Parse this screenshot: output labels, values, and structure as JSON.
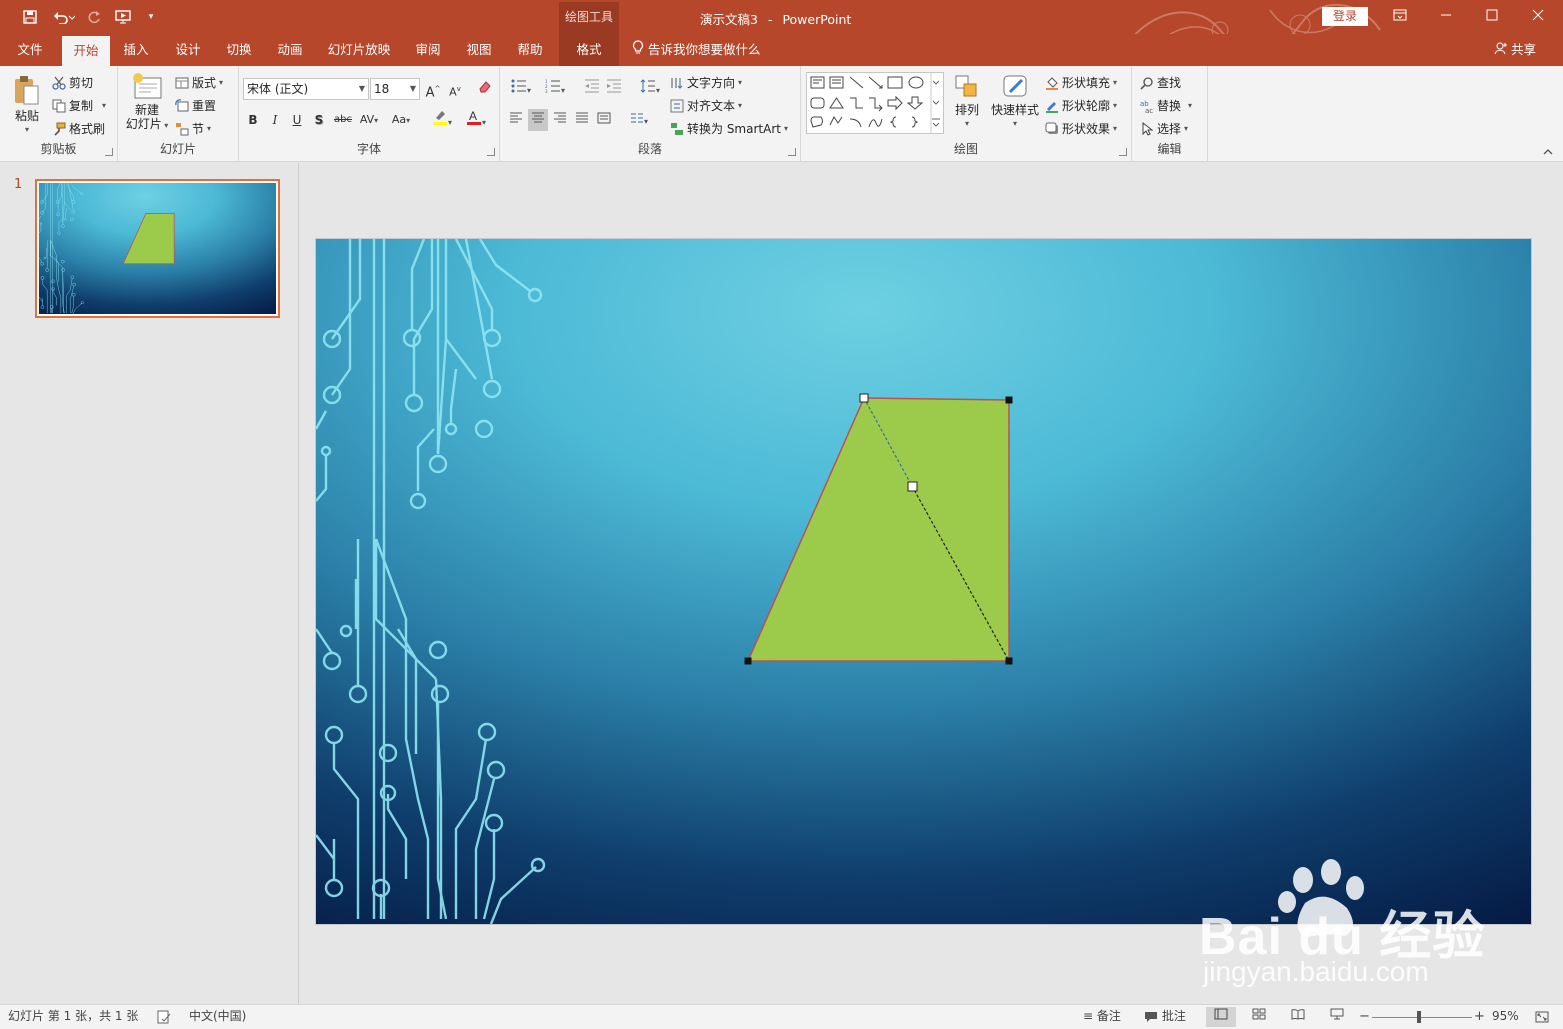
{
  "window": {
    "context_group": "绘图工具",
    "title_doc": "演示文稿3",
    "title_sep": "-",
    "title_app": "PowerPoint",
    "login": "登录"
  },
  "tabs": [
    {
      "label": "文件"
    },
    {
      "label": "开始"
    },
    {
      "label": "插入"
    },
    {
      "label": "设计"
    },
    {
      "label": "切换"
    },
    {
      "label": "动画"
    },
    {
      "label": "幻灯片放映"
    },
    {
      "label": "审阅"
    },
    {
      "label": "视图"
    },
    {
      "label": "帮助"
    },
    {
      "label": "格式"
    }
  ],
  "tell_me": "告诉我你想要做什么",
  "share": "共享",
  "ribbon": {
    "clipboard": {
      "label": "剪贴板",
      "paste": "粘贴",
      "cut": "剪切",
      "copy": "复制",
      "format_painter": "格式刷"
    },
    "slides": {
      "label": "幻灯片",
      "new_slide_1": "新建",
      "new_slide_2": "幻灯片",
      "layout": "版式",
      "reset": "重置",
      "section": "节"
    },
    "font": {
      "label": "字体",
      "font_name": "宋体 (正文)",
      "font_size": "18",
      "bold": "B",
      "italic": "I",
      "underline": "U",
      "shadow": "S",
      "strike": "abc",
      "spacing": "AV",
      "case": "Aa",
      "grow": "A",
      "shrink": "A"
    },
    "paragraph": {
      "label": "段落",
      "text_direction": "文字方向",
      "align_text": "对齐文本",
      "smartart": "转换为 SmartArt"
    },
    "drawing": {
      "label": "绘图",
      "arrange": "排列",
      "quick_styles": "快速样式",
      "shape_fill": "形状填充",
      "shape_outline": "形状轮廓",
      "shape_effects": "形状效果"
    },
    "editing": {
      "label": "编辑",
      "find": "查找",
      "replace": "替换",
      "select": "选择"
    }
  },
  "slide_panel": {
    "number": "1"
  },
  "status": {
    "slide_info": "幻灯片 第 1 张，共 1 张",
    "language": "中文(中国)",
    "notes": "备注",
    "comments": "批注",
    "zoom": "95%",
    "zoom_level": 0.95
  },
  "watermark": {
    "brand": "Bai du 经验",
    "url": "jingyan.baidu.com"
  },
  "colors": {
    "accent": "#b7472a",
    "shape_fill": "#9ccb4b",
    "shape_outline": "#c0504d"
  }
}
